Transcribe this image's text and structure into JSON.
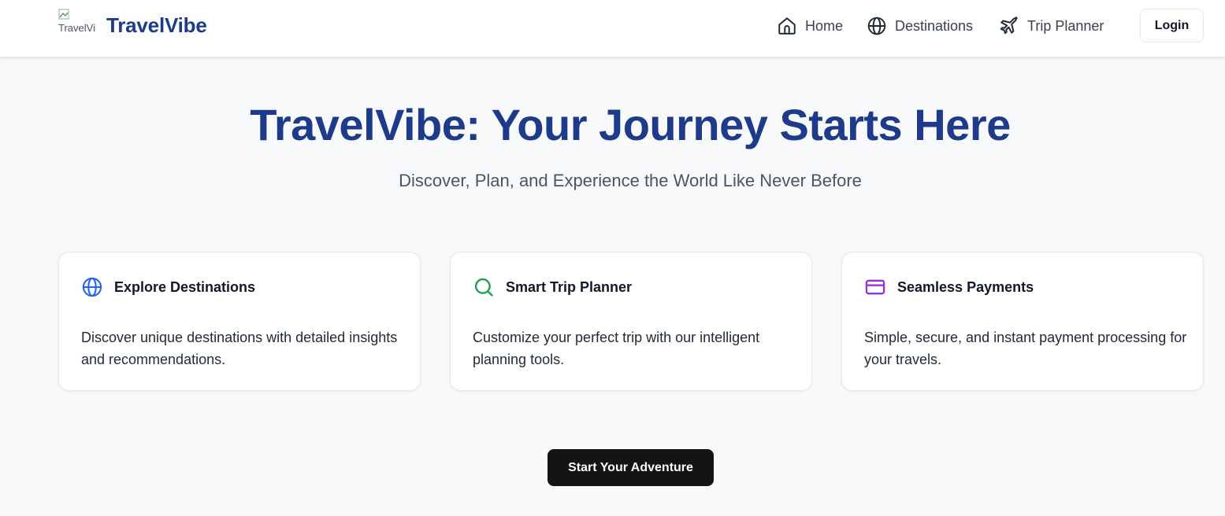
{
  "header": {
    "logo_alt": "TravelVibe",
    "brand": "TravelVibe",
    "nav": [
      {
        "label": "Home",
        "icon": "home-icon"
      },
      {
        "label": "Destinations",
        "icon": "globe-icon"
      },
      {
        "label": "Trip Planner",
        "icon": "plane-icon"
      }
    ],
    "login_label": "Login"
  },
  "hero": {
    "title": "TravelVibe: Your Journey Starts Here",
    "subtitle": "Discover, Plan, and Experience the World Like Never Before"
  },
  "features": [
    {
      "icon": "globe-icon",
      "icon_color": "#2563eb",
      "title": "Explore Destinations",
      "description": "Discover unique destinations with detailed insights and recommendations."
    },
    {
      "icon": "search-icon",
      "icon_color": "#16a34a",
      "title": "Smart Trip Planner",
      "description": "Customize your perfect trip with our intelligent planning tools."
    },
    {
      "icon": "credit-card-icon",
      "icon_color": "#9333ea",
      "title": "Seamless Payments",
      "description": "Simple, secure, and instant payment processing for your travels."
    }
  ],
  "cta": {
    "label": "Start Your Adventure"
  },
  "colors": {
    "brand": "#1e3a8a",
    "cta_bg": "#141414",
    "page_bg": "#f8f9fb"
  }
}
